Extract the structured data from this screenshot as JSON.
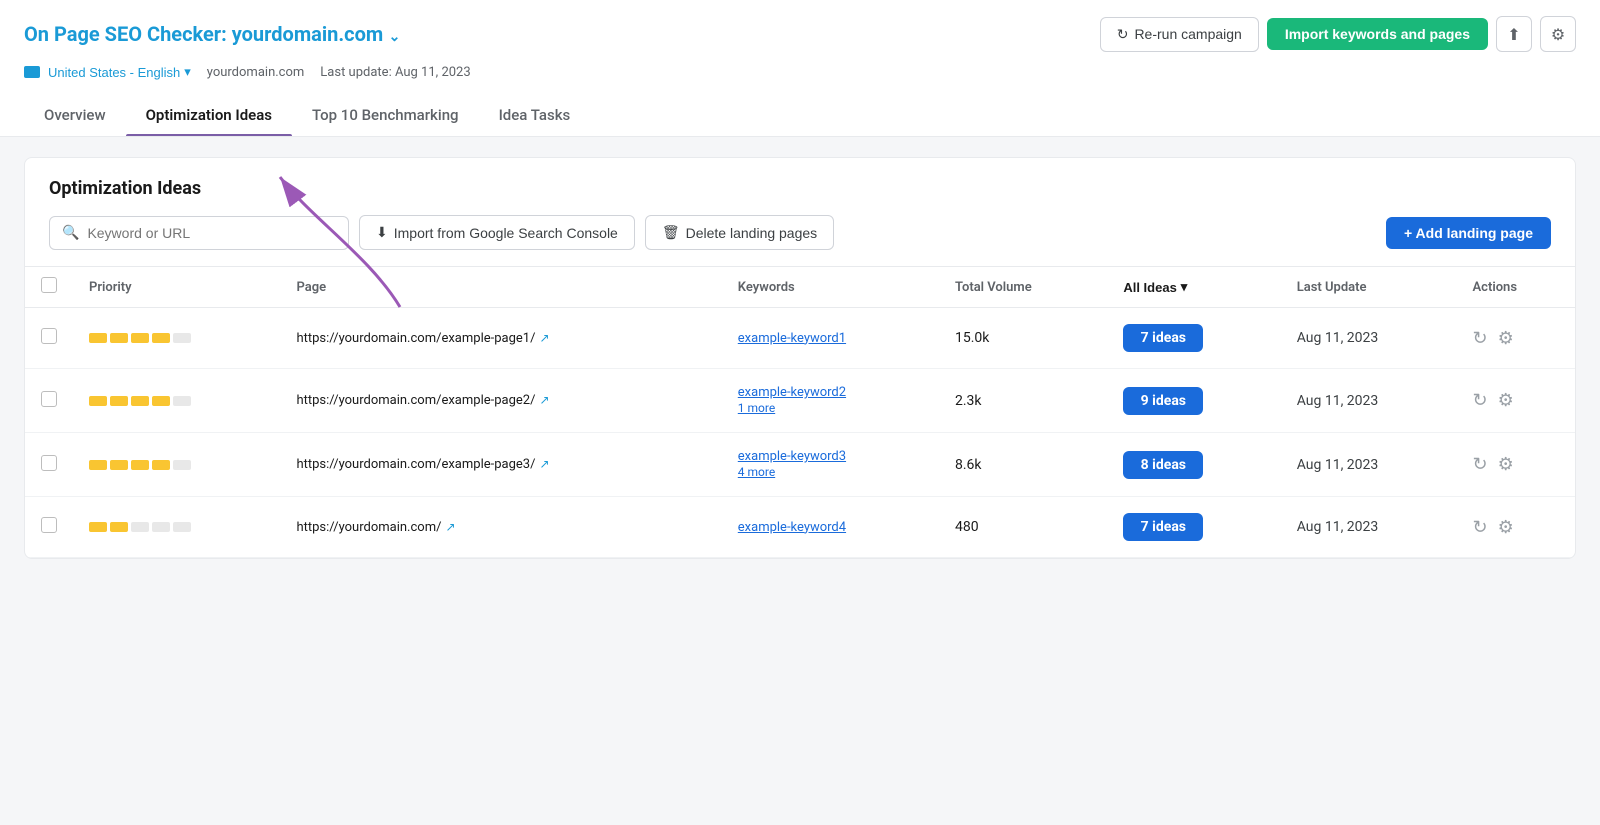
{
  "header": {
    "title_prefix": "On Page SEO Checker: ",
    "domain": "yourdomain.com",
    "last_update_label": "Last update: Aug 11, 2023",
    "domain_display": "yourdomain.com",
    "locale": "United States - English",
    "rerun_label": "Re-run campaign",
    "import_kw_label": "Import keywords and pages"
  },
  "tabs": [
    {
      "id": "overview",
      "label": "Overview"
    },
    {
      "id": "optimization-ideas",
      "label": "Optimization Ideas"
    },
    {
      "id": "top10",
      "label": "Top 10 Benchmarking"
    },
    {
      "id": "idea-tasks",
      "label": "Idea Tasks"
    }
  ],
  "card": {
    "title": "Optimization Ideas",
    "search_placeholder": "Keyword or URL",
    "import_gsc_label": "Import from Google Search Console",
    "delete_label": "Delete landing pages",
    "add_label": "+ Add landing page"
  },
  "table": {
    "columns": [
      {
        "id": "checkbox",
        "label": ""
      },
      {
        "id": "priority",
        "label": "Priority"
      },
      {
        "id": "page",
        "label": "Page"
      },
      {
        "id": "keywords",
        "label": "Keywords"
      },
      {
        "id": "volume",
        "label": "Total Volume"
      },
      {
        "id": "ideas",
        "label": "All Ideas"
      },
      {
        "id": "last_update",
        "label": "Last Update"
      },
      {
        "id": "actions",
        "label": "Actions"
      }
    ],
    "rows": [
      {
        "priority_filled": 4,
        "priority_empty": 1,
        "page_url": "https://yourdomain.com/example-page1/",
        "keyword": "example-keyword1",
        "keyword_extra": null,
        "volume": "15.0k",
        "ideas": "7 ideas",
        "last_update": "Aug 11, 2023"
      },
      {
        "priority_filled": 4,
        "priority_empty": 1,
        "page_url": "https://yourdomain.com/example-page2/",
        "keyword": "example-keyword2",
        "keyword_extra": "1 more",
        "volume": "2.3k",
        "ideas": "9 ideas",
        "last_update": "Aug 11, 2023"
      },
      {
        "priority_filled": 4,
        "priority_empty": 1,
        "page_url": "https://yourdomain.com/example-page3/",
        "keyword": "example-keyword3",
        "keyword_extra": "4 more",
        "volume": "8.6k",
        "ideas": "8 ideas",
        "last_update": "Aug 11, 2023"
      },
      {
        "priority_filled": 2,
        "priority_empty": 3,
        "page_url": "https://yourdomain.com/",
        "keyword": "example-keyword4",
        "keyword_extra": null,
        "volume": "480",
        "ideas": "7 ideas",
        "last_update": "Aug 11, 2023"
      }
    ]
  }
}
